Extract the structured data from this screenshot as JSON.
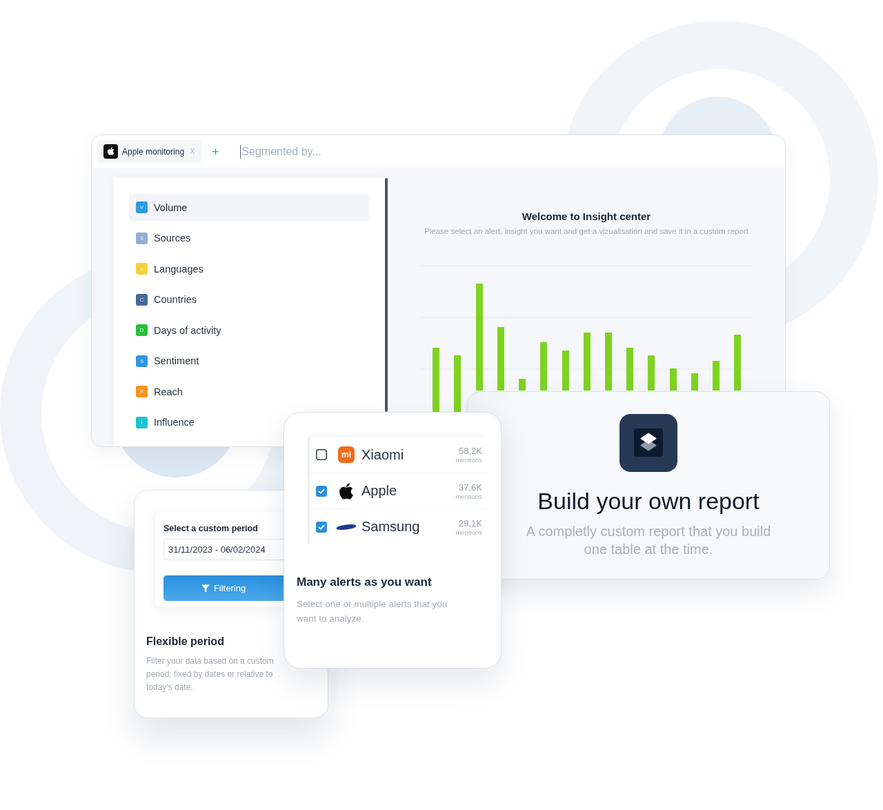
{
  "main_window": {
    "tab": {
      "label": "Apple monitoring",
      "close": "X"
    },
    "add_tab": "+",
    "segment_field": {
      "placeholder": "Segmented by..."
    },
    "insights": [
      {
        "badge": "V",
        "label": "Volume",
        "color": "#2d9cdb",
        "selected": true
      },
      {
        "badge": "S",
        "label": "Sources",
        "color": "#8fb0d3",
        "selected": false
      },
      {
        "badge": "L",
        "label": "Languages",
        "color": "#f8d23a",
        "selected": false
      },
      {
        "badge": "C",
        "label": "Countries",
        "color": "#44699c",
        "selected": false
      },
      {
        "badge": "D",
        "label": "Days of activity",
        "color": "#2bbf3a",
        "selected": false
      },
      {
        "badge": "S",
        "label": "Sentiment",
        "color": "#2f97e3",
        "selected": false
      },
      {
        "badge": "R",
        "label": "Reach",
        "color": "#f8931f",
        "selected": false
      },
      {
        "badge": "I",
        "label": "Influence",
        "color": "#1ec3cf",
        "selected": false
      }
    ],
    "welcome": {
      "title": "Welcome to Insight center",
      "subtitle": "Please select an alert, insight you want and get a vizualisation and save it in a custom report"
    }
  },
  "report_card": {
    "title": "Build your own report",
    "description": "A completly custom report that you build one table at the time."
  },
  "period_card": {
    "field_label": "Select a custom period",
    "date_range": "31/11/2023 - 06/02/2024",
    "button": "Filtering",
    "title": "Flexible period",
    "description": "Filter your data based on a custom period: fixed by dates or relative to today's date."
  },
  "alerts_card": {
    "alerts": [
      {
        "name": "Xiaomi",
        "count": "58,2K",
        "unit": "mentions",
        "checked": false,
        "logo": {
          "kind": "text",
          "text": "mi"
        }
      },
      {
        "name": "Apple",
        "count": "37,6K",
        "unit": "mentions",
        "checked": true,
        "logo": {
          "kind": "apple"
        }
      },
      {
        "name": "Samsung",
        "count": "29,1K",
        "unit": "mentions",
        "checked": true,
        "logo": {
          "kind": "oval"
        }
      }
    ],
    "title": "Many alerts as you want",
    "description": "Select one or multiple alerts that you want to analyze."
  }
}
